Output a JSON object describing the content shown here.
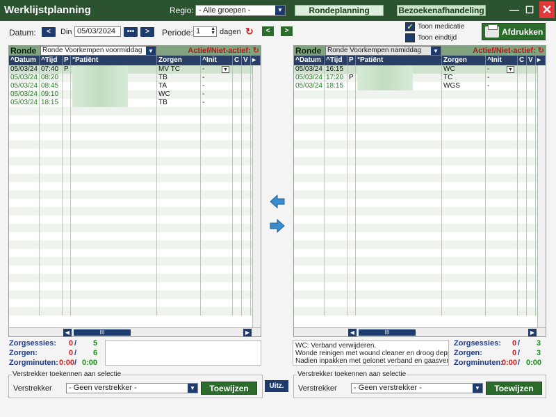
{
  "app": {
    "title": "Werklijstplanning",
    "regio_label": "Regio:",
    "regio_value": "- Alle groepen -",
    "tabs": [
      "Rondeplanning",
      "Bezoekenafhandeling"
    ],
    "win_min": "—",
    "win_max": "☐",
    "win_close": "✕"
  },
  "toolbar": {
    "datum_label": "Datum:",
    "prev": "<",
    "day": "Din",
    "date": "05/03/2024",
    "dots": "•••",
    "next": ">",
    "periode_label": "Periode:",
    "periode_value": "1",
    "dagen_label": "dagen",
    "shift_left": "<",
    "shift_right": ">",
    "toon_medicatie": "Toon medicatie",
    "toon_eindtijd": "Toon eindtijd",
    "print_label": "Afdrukken"
  },
  "columns": [
    "^Datum",
    "^Tijd",
    "P",
    "°Patiënt",
    "Zorgen",
    "^Init",
    "C",
    "V",
    "▸"
  ],
  "left": {
    "ronde_label": "Ronde",
    "ronde_value": "Ronde Voorkempen voormiddag",
    "actief_label": "Actief/Niet-actief:",
    "rows": [
      {
        "datum": "05/03/24",
        "tijd": "07:40",
        "p": "P",
        "zorgen": "MV TC",
        "init": "-",
        "selected": true
      },
      {
        "datum": "05/03/24",
        "tijd": "08:20",
        "p": "",
        "zorgen": "TB",
        "init": "-"
      },
      {
        "datum": "05/03/24",
        "tijd": "08:45",
        "p": "",
        "zorgen": "TA",
        "init": "-"
      },
      {
        "datum": "05/03/24",
        "tijd": "09:10",
        "p": "",
        "zorgen": "WC",
        "init": "-"
      },
      {
        "datum": "05/03/24",
        "tijd": "18:15",
        "p": "",
        "zorgen": "TB",
        "init": "-"
      }
    ],
    "scroll_thumb": "III",
    "stats": {
      "zorgsessies_label": "Zorgsessies:",
      "zorgsessies_a": "0",
      "zorgsessies_b": "5",
      "zorgen_label": "Zorgen:",
      "zorgen_a": "0",
      "zorgen_b": "6",
      "zorgminuten_label": "Zorgminuten:",
      "zorgminuten_a": "0:00",
      "zorgminuten_b": "0:00",
      "sep": "/"
    },
    "note": "",
    "verstrekker_legend": "Verstrekker toekennen aan selectie",
    "verstrekker_label": "Verstrekker",
    "verstrekker_value": "- Geen verstrekker -",
    "toewijzen": "Toewijzen"
  },
  "right": {
    "ronde_label": "Ronde",
    "ronde_value": "Ronde Voorkempen namiddag",
    "actief_label": "Actief/Niet-actief:",
    "rows": [
      {
        "datum": "05/03/24",
        "tijd": "16:15",
        "p": "",
        "zorgen": "WC",
        "init": "-",
        "selected": true
      },
      {
        "datum": "05/03/24",
        "tijd": "17:20",
        "p": "P",
        "zorgen": "TC",
        "init": "-"
      },
      {
        "datum": "05/03/24",
        "tijd": "18:15",
        "p": "",
        "zorgen": "WGS",
        "init": "-"
      }
    ],
    "scroll_thumb": "III",
    "stats": {
      "zorgsessies_label": "Zorgsessies:",
      "zorgsessies_a": "0",
      "zorgsessies_b": "3",
      "zorgen_label": "Zorgen:",
      "zorgen_a": "0",
      "zorgen_b": "3",
      "zorgminuten_label": "Zorgminuten:",
      "zorgminuten_a": "0:00",
      "zorgminuten_b": "0:00",
      "sep": "/"
    },
    "note": [
      "WC: Verband verwijderen.",
      "Wonde reinigen met wound cleaner en droog depp",
      "Nadien inpakken met gelonet verband en gaasver"
    ],
    "verstrekker_legend": "Verstrekker toekennen aan selectie",
    "verstrekker_label": "Verstrekker",
    "verstrekker_value": "- Geen verstrekker -",
    "toewijzen": "Toewijzen"
  },
  "uitz": "Uitz.",
  "colors": {
    "title_bar": "#2b5330",
    "header_blue": "#2a3f66",
    "accent_green": "#2b6b2b",
    "row_green": "#1e8a1e",
    "actief_red": "#b01818"
  },
  "icons": {
    "refresh": "refresh-icon",
    "print": "printer-icon",
    "move_left": "arrow-left-icon",
    "move_right": "arrow-right-icon"
  }
}
